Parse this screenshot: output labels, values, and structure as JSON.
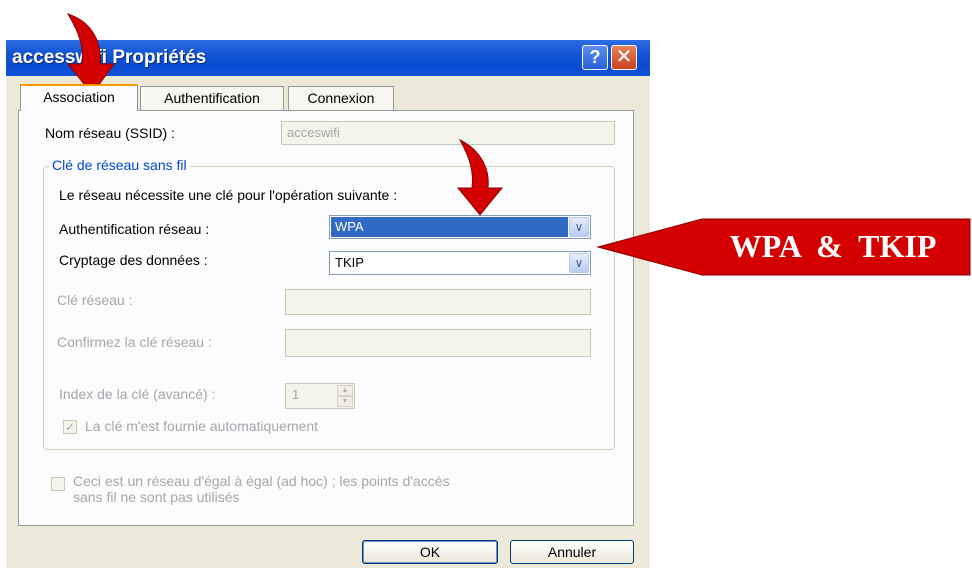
{
  "window": {
    "title": "accesswifi Propriétés",
    "help_label": "?",
    "close_label": "✕"
  },
  "tabs": [
    {
      "label": "Association",
      "active": true
    },
    {
      "label": "Authentification",
      "active": false
    },
    {
      "label": "Connexion",
      "active": false
    }
  ],
  "ssid": {
    "label": "Nom réseau (SSID) :",
    "value": "acceswifi"
  },
  "wireless_key": {
    "legend": "Clé de réseau sans fil",
    "requirement_text": "Le réseau nécessite une clé pour l'opération suivante :",
    "network_auth": {
      "label": "Authentification réseau :",
      "value": "WPA"
    },
    "data_encryption": {
      "label": "Cryptage des données :",
      "value": "TKIP"
    },
    "network_key": {
      "label": "Clé réseau :",
      "value": ""
    },
    "confirm_key": {
      "label": "Confirmez la clé réseau :",
      "value": ""
    },
    "key_index": {
      "label": "Index de la clé (avancé) :",
      "value": "1"
    },
    "auto_key": {
      "label": "La clé m'est fournie automatiquement",
      "checked": true
    }
  },
  "adhoc": {
    "label_line1": "Ceci est un réseau d'égal à égal (ad hoc) ; les points d'accès",
    "label_line2": "sans fil ne sont pas utilisés",
    "checked": false
  },
  "buttons": {
    "ok": "OK",
    "cancel": "Annuler"
  },
  "annotation": {
    "callout_text": "WPA  &  TKIP",
    "color": "#d40000"
  },
  "colors": {
    "titlebar": "#0a4cd0",
    "tab_highlight": "#ff9a00",
    "group_legend": "#0046d5",
    "selection": "#316ac5"
  }
}
